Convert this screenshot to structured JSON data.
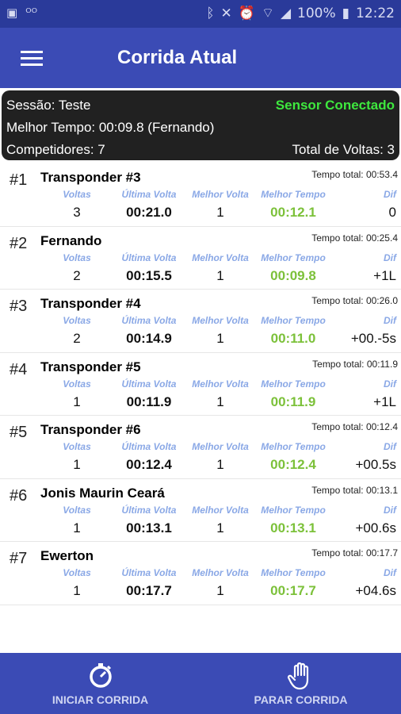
{
  "statusbar": {
    "left_icons": [
      "image-icon",
      "voicemail-icon"
    ],
    "battery": "100%",
    "time": "12:22"
  },
  "appbar": {
    "title": "Corrida Atual"
  },
  "session": {
    "sessao": "Sessão: Teste",
    "sensor": "Sensor Conectado",
    "melhor_tempo": "Melhor Tempo: 00:09.8 (Fernando)",
    "competidores": "Competidores: 7",
    "total_voltas": "Total de Voltas: 3"
  },
  "headers": {
    "voltas": "Voltas",
    "ultima_volta": "Última Volta",
    "melhor_volta": "Melhor Volta",
    "melhor_tempo": "Melhor Tempo",
    "dif": "Dif"
  },
  "competitors": [
    {
      "pos": "#1",
      "name": "Transponder #3",
      "total": "Tempo total: 00:53.4",
      "voltas": "3",
      "ultima": "00:21.0",
      "melhor_volta": "1",
      "melhor_tempo": "00:12.1",
      "dif": "0"
    },
    {
      "pos": "#2",
      "name": "Fernando",
      "total": "Tempo total: 00:25.4",
      "voltas": "2",
      "ultima": "00:15.5",
      "melhor_volta": "1",
      "melhor_tempo": "00:09.8",
      "dif": "+1L"
    },
    {
      "pos": "#3",
      "name": "Transponder #4",
      "total": "Tempo total: 00:26.0",
      "voltas": "2",
      "ultima": "00:14.9",
      "melhor_volta": "1",
      "melhor_tempo": "00:11.0",
      "dif": "+00.-5s"
    },
    {
      "pos": "#4",
      "name": "Transponder #5",
      "total": "Tempo total: 00:11.9",
      "voltas": "1",
      "ultima": "00:11.9",
      "melhor_volta": "1",
      "melhor_tempo": "00:11.9",
      "dif": "+1L"
    },
    {
      "pos": "#5",
      "name": "Transponder #6",
      "total": "Tempo total: 00:12.4",
      "voltas": "1",
      "ultima": "00:12.4",
      "melhor_volta": "1",
      "melhor_tempo": "00:12.4",
      "dif": "+00.5s"
    },
    {
      "pos": "#6",
      "name": "Jonis Maurin Ceará",
      "total": "Tempo total: 00:13.1",
      "voltas": "1",
      "ultima": "00:13.1",
      "melhor_volta": "1",
      "melhor_tempo": "00:13.1",
      "dif": "+00.6s"
    },
    {
      "pos": "#7",
      "name": "Ewerton",
      "total": "Tempo total: 00:17.7",
      "voltas": "1",
      "ultima": "00:17.7",
      "melhor_volta": "1",
      "melhor_tempo": "00:17.7",
      "dif": "+04.6s"
    }
  ],
  "bottom": {
    "start_label": "INICIAR CORRIDA",
    "stop_label": "PARAR CORRIDA"
  },
  "colors": {
    "primary": "#3b4bb5",
    "statusbar": "#2a3a9a",
    "sensor": "#3ee83e",
    "best_time": "#7cc13a",
    "header": "#8aa8e6"
  }
}
